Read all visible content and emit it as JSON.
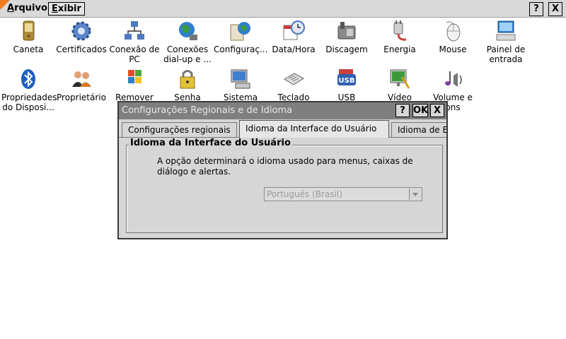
{
  "menubar": {
    "items": [
      {
        "label_underlined": "A",
        "label_rest": "rquivo"
      },
      {
        "label_underlined": "E",
        "label_rest": "xibir"
      }
    ],
    "help_label": "?",
    "close_label": "X"
  },
  "icons": [
    {
      "label": "Caneta",
      "icon": "pen-pda-icon"
    },
    {
      "label": "Certificados",
      "icon": "gear-certificate-icon"
    },
    {
      "label": "Conexão de\nPC",
      "icon": "pc-network-icon"
    },
    {
      "label": "Conexões\ndial-up e ...",
      "icon": "globe-network-icon"
    },
    {
      "label": "Configuraç...",
      "icon": "globe-config-icon"
    },
    {
      "label": "Data/Hora",
      "icon": "calendar-clock-icon"
    },
    {
      "label": "Discagem",
      "icon": "phone-icon"
    },
    {
      "label": "Energia",
      "icon": "power-plug-icon"
    },
    {
      "label": "Mouse",
      "icon": "mouse-icon"
    },
    {
      "label": "Painel de\nentrada",
      "icon": "input-panel-icon"
    },
    {
      "label": "Propriedades\ndo Disposi...",
      "icon": "bluetooth-icon"
    },
    {
      "label": "Proprietário",
      "icon": "owner-people-icon"
    },
    {
      "label": "Remover\nP",
      "icon": "windows-remove-icon"
    },
    {
      "label": "Senha",
      "icon": "password-lock-icon"
    },
    {
      "label": "Sistema",
      "icon": "system-computer-icon"
    },
    {
      "label": "Teclado",
      "icon": "keyboard-icon"
    },
    {
      "label": "USB",
      "icon": "usb-icon"
    },
    {
      "label": "Vídeo",
      "icon": "display-icon"
    },
    {
      "label": "Volume e\nons",
      "icon": "volume-sound-icon"
    }
  ],
  "dialog": {
    "title": "Configurações Regionais e de Idioma",
    "help_label": "?",
    "ok_label": "OK",
    "close_label": "X",
    "tabs": [
      {
        "label": "Configurações regionais"
      },
      {
        "label": "Idioma da Interface do Usuário"
      },
      {
        "label": "Idioma de E"
      }
    ],
    "group_title": "Idioma da Interface do Usuário",
    "description": "A opção determinará o idioma usado para menus, caixas de diálogo e alertas.",
    "language_select_value": "Português (Brasil)"
  },
  "colors": {
    "menubar": "#d9d9d9",
    "titlebar_inactive": "#7f7f7f",
    "dialog_face": "#d6d6d6",
    "accent_orange": "#f07a1e"
  }
}
